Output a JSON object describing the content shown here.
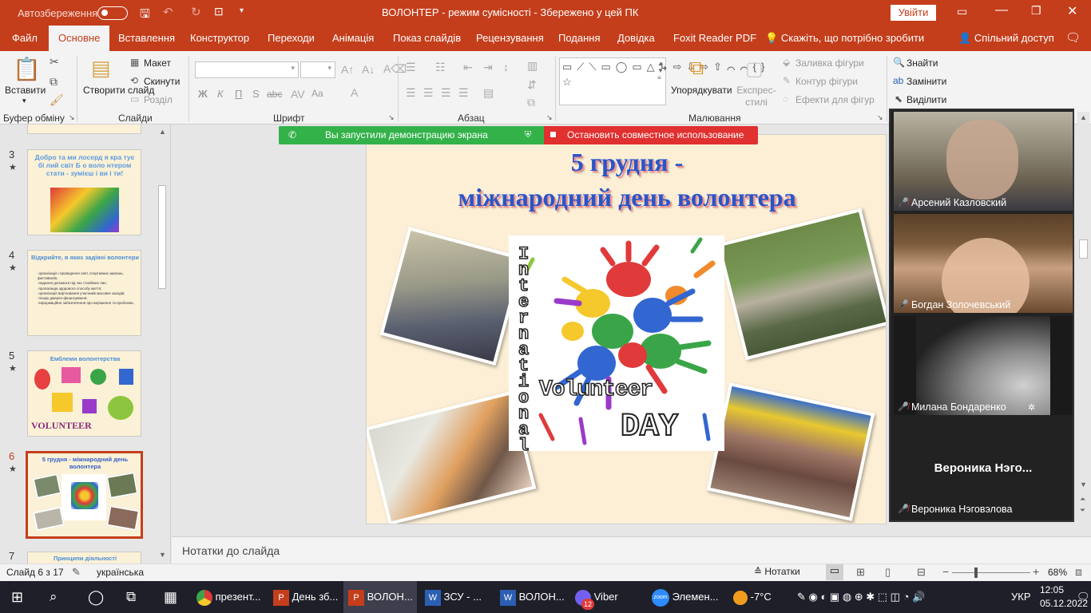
{
  "titlebar": {
    "autosave": "Автозбереження",
    "title": "ВОЛОНТЕР  -  режим сумісності  -  Збережено у цей ПК",
    "signin": "Увійти"
  },
  "tabs": [
    "Файл",
    "Основне",
    "Вставлення",
    "Конструктор",
    "Переходи",
    "Анімація",
    "Показ слайдів",
    "Рецензування",
    "Подання",
    "Довідка",
    "Foxit Reader PDF"
  ],
  "tellme": "Скажіть, що потрібно зробити",
  "share": "Спільний доступ",
  "ribbon": {
    "paste": "Вставити",
    "clipboard_label": "Буфер обміну",
    "new_slide": "Створити слайд",
    "layout": "Макет",
    "reset": "Скинути",
    "section": "Розділ",
    "slides_label": "Слайди",
    "font_label": "Шрифт",
    "paragraph_label": "Абзац",
    "arrange": "Упорядкувати",
    "quick_styles": "Експрес-стилі",
    "shape_fill": "Заливка фігури",
    "shape_outline": "Контур фігури",
    "shape_effects": "Ефекти для фігур",
    "drawing_label": "Малювання",
    "find": "Знайти",
    "replace": "Замінити",
    "select": "Виділити",
    "bold": "Ж",
    "italic": "К",
    "underline": "П",
    "shadow": "S",
    "strike": "abc",
    "spacing": "Aa"
  },
  "sharebar": {
    "sharing": "Вы запустили демонстрацию экрана",
    "stop": "Остановить совместное использование"
  },
  "thumbnails": [
    {
      "num": "3",
      "text": "Добро  та ми лосерд я кра тує бі лий світ Б о воло нтером  стати - зумієш і ви і ти!"
    },
    {
      "num": "4",
      "title": "Відкрийте, в яких задіяні волонтери",
      "items": [
        "-організація і проведення свят, спортивних змагань, фестивалів;",
        "-надання допомоги під час стихійних лих;",
        "-пропаганда здорового способу життя;",
        "-організація вар'єювання учасників масових заходів;",
        "-пошук джерел фінансування;",
        "-інформаційне забезпечення про вирішення та проблема."
      ]
    },
    {
      "num": "5",
      "title": "Емблеми волонтерства",
      "brand": "VOLUNTEER"
    },
    {
      "num": "6",
      "title": "5 грудня - міжнародний день волонтера"
    },
    {
      "num": "7",
      "title": "Принципи діяльності"
    }
  ],
  "slide": {
    "title_line1": "5 грудня -",
    "title_line2": "міжнародний день волонтера",
    "vertical": "International",
    "volunteer": "Volunteer",
    "day": "DAY"
  },
  "participants": [
    {
      "name": "Арсений Казловский"
    },
    {
      "name": "Богдан Золочевський"
    },
    {
      "name": "Милана Бондаренко"
    },
    {
      "name": "Вероника Нэговэлова",
      "short": "Вероника  Нэго..."
    }
  ],
  "notes": "Нотатки до слайда",
  "status": {
    "slide": "Слайд 6 з 17",
    "lang": "українська",
    "notes_btn": "Нотатки",
    "zoom": "68%"
  },
  "taskbar": {
    "items": [
      "презент...",
      "День зб...",
      "ВОЛОН...",
      "ЗСУ - ...",
      "ВОЛОН...",
      "Viber",
      "Элемен..."
    ],
    "viber_badge": "12",
    "temp": "-7°C",
    "lang": "УКР",
    "time": "12:05",
    "date": "05.12.2022"
  },
  "colors": {
    "accent": "#c43e1c",
    "share_green": "#34b24a",
    "share_red": "#e0302f",
    "title_blue": "#2a55c8"
  }
}
